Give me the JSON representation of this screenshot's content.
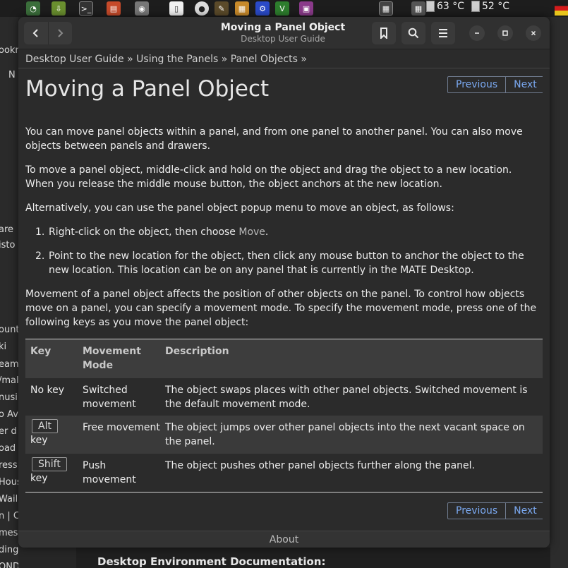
{
  "system_panel": {
    "temp1": "63 °C",
    "temp2": "52 °C"
  },
  "background_window": {
    "left_fragments": [
      "ookm",
      "N",
      "are",
      "isto",
      "ount",
      "ki",
      "eam",
      "/mal",
      "nusi",
      "o Av",
      "er d",
      "oad",
      "ress",
      "Hous",
      "Wail",
      "n | C",
      "mes",
      "ding Cassell..",
      "OND / PLAZA"
    ],
    "bottom_heading": "Desktop Environment Documentation:"
  },
  "window": {
    "title": "Moving a Panel Object",
    "subtitle": "Desktop User Guide"
  },
  "breadcrumb": {
    "items": [
      "Desktop User Guide",
      "Using the Panels",
      "Panel Objects"
    ],
    "separator": "»"
  },
  "pager": {
    "previous": "Previous",
    "next": "Next"
  },
  "page": {
    "heading": "Moving a Panel Object",
    "para1": "You can move panel objects within a panel, and from one panel to another panel. You can also move objects between panels and drawers.",
    "para2": "To move a panel object, middle-click and hold on the object and drag the object to a new location. When you release the middle mouse button, the object anchors at the new location.",
    "para3": "Alternatively, you can use the panel object popup menu to move an object, as follows:",
    "steps": [
      {
        "num": "1.",
        "before": "Right-click on the object, then choose ",
        "gui": "Move",
        "after": "."
      },
      {
        "num": "2.",
        "text": "Point to the new location for the object, then click any mouse button to anchor the object to the new location. This location can be on any panel that is currently in the MATE Desktop."
      }
    ],
    "para4": "Movement of a panel object affects the position of other objects on the panel. To control how objects move on a panel, you can specify a movement mode. To specify the movement mode, press one of the following keys as you move the panel object:"
  },
  "table": {
    "headers": [
      "Key",
      "Movement Mode",
      "Description"
    ],
    "rows": [
      {
        "key": "No key",
        "key_cap": "",
        "mode": "Switched movement",
        "desc": "The object swaps places with other panel objects. Switched movement is the default movement mode."
      },
      {
        "key": "key",
        "key_cap": "Alt",
        "mode": "Free movement",
        "desc": "The object jumps over other panel objects into the next vacant space on the panel."
      },
      {
        "key": "key",
        "key_cap": "Shift",
        "mode": "Push movement",
        "desc": "The object pushes other panel objects further along the panel."
      }
    ]
  },
  "footer": {
    "about": "About"
  },
  "colors": {
    "link": "#7aa8f0",
    "window_bg": "#2b2b2b",
    "titlebar_bg": "#303030",
    "table_header_bg": "#3d3d3d"
  }
}
